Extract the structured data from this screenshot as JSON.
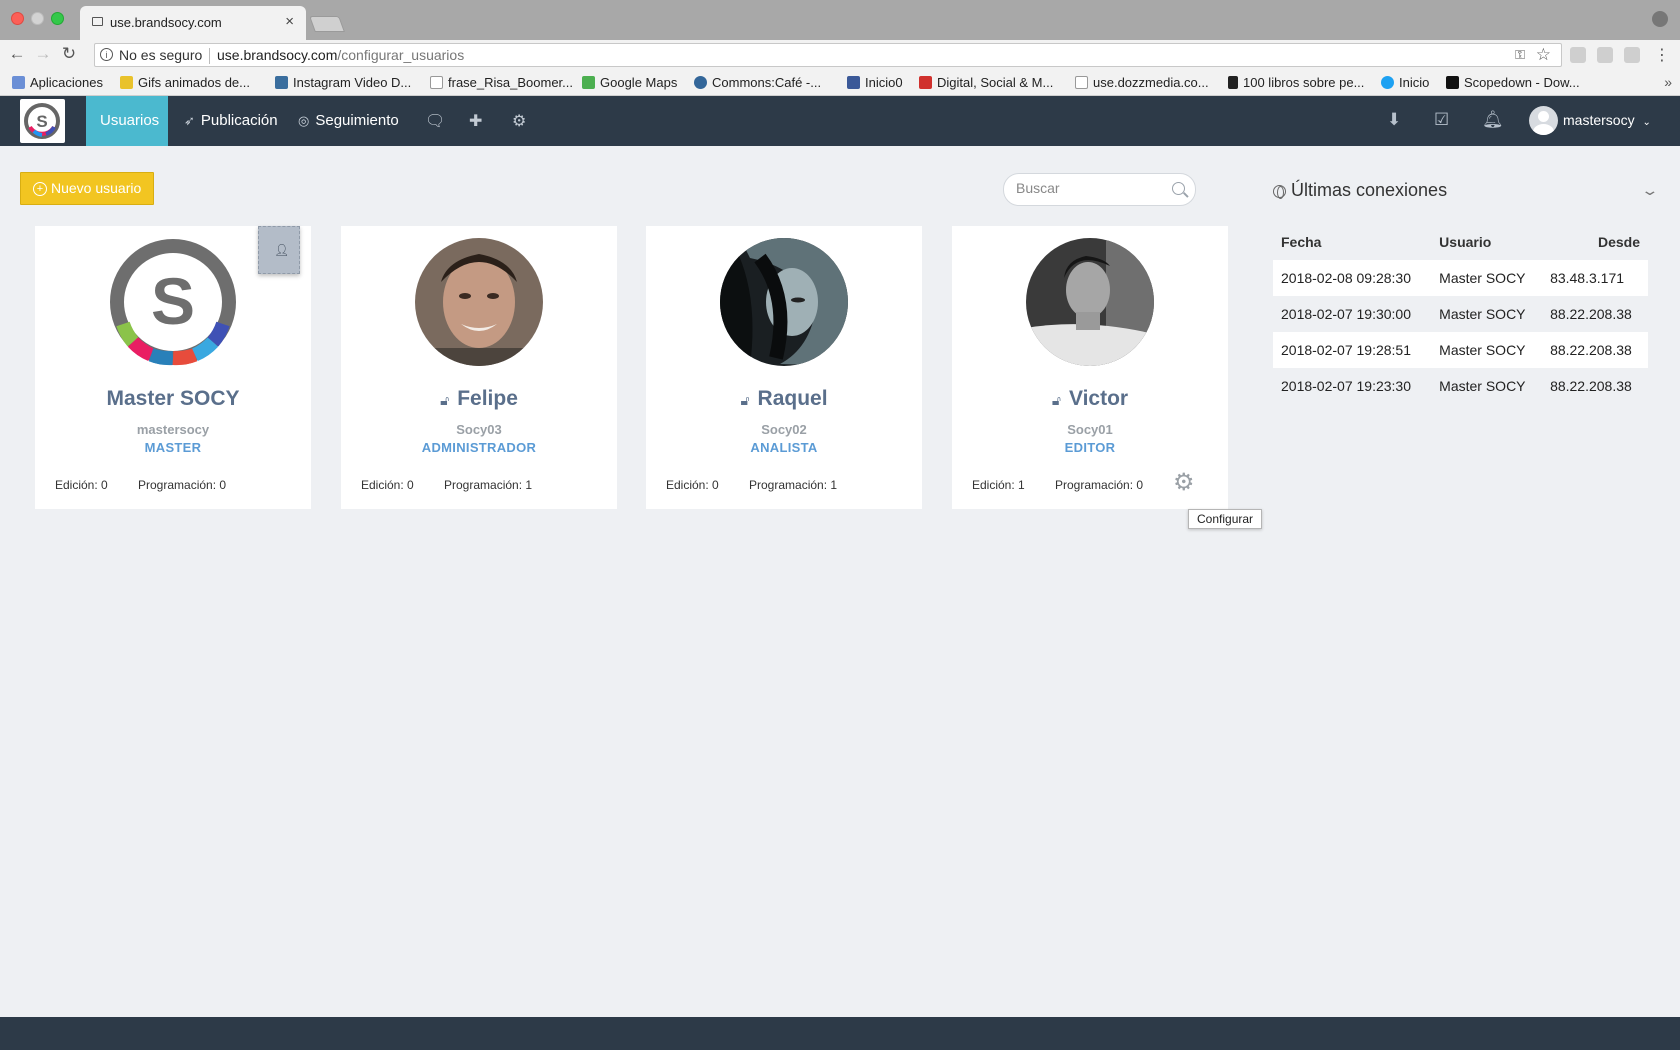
{
  "browser": {
    "tab_title": "use.brandsocy.com",
    "tab_close": "×",
    "security_text": "No es seguro",
    "url_host": "use.brandsocy.com",
    "url_path": "/configurar_usuarios",
    "bookmarks": [
      "Aplicaciones",
      "Gifs animados de...",
      "Instagram Video D...",
      "frase_Risa_Boomer...",
      "Google Maps",
      "Commons:Café -...",
      "Inicio0",
      "Digital, Social & M...",
      "use.dozzmedia.co...",
      "100 libros sobre pe...",
      "Inicio",
      "Scopedown - Dow..."
    ]
  },
  "nav": {
    "items": [
      {
        "label": "Usuarios"
      },
      {
        "label": "Publicación"
      },
      {
        "label": "Seguimiento"
      }
    ],
    "user": "mastersocy"
  },
  "toolbar": {
    "new_user_label": "Nuevo usuario",
    "search_placeholder": "Buscar"
  },
  "cards": [
    {
      "name": "Master SOCY",
      "username": "mastersocy",
      "role": "MASTER",
      "edicion": "Edición: 0",
      "programacion": "Programación: 0"
    },
    {
      "name": "Felipe",
      "username": "Socy03",
      "role": "ADMINISTRADOR",
      "edicion": "Edición: 0",
      "programacion": "Programación: 1"
    },
    {
      "name": "Raquel",
      "username": "Socy02",
      "role": "ANALISTA",
      "edicion": "Edición: 0",
      "programacion": "Programación: 1"
    },
    {
      "name": "Victor",
      "username": "Socy01",
      "role": "EDITOR",
      "edicion": "Edición: 1",
      "programacion": "Programación: 0"
    }
  ],
  "tooltip": "Configurar",
  "connections": {
    "title": "Últimas conexiones",
    "headers": [
      "Fecha",
      "Usuario",
      "Desde"
    ],
    "rows": [
      [
        "2018-02-08 09:28:30",
        "Master SOCY",
        "83.48.3.171"
      ],
      [
        "2018-02-07 19:30:00",
        "Master SOCY",
        "88.22.208.38"
      ],
      [
        "2018-02-07 19:28:51",
        "Master SOCY",
        "88.22.208.38"
      ],
      [
        "2018-02-07 19:23:30",
        "Master SOCY",
        "88.22.208.38"
      ]
    ]
  },
  "colors": {
    "nav_bg": "#2d3a48",
    "nav_active": "#4bb9cf",
    "button_yellow": "#f2c521",
    "name_color": "#5a6f8b",
    "role_color": "#5b9bd5"
  }
}
